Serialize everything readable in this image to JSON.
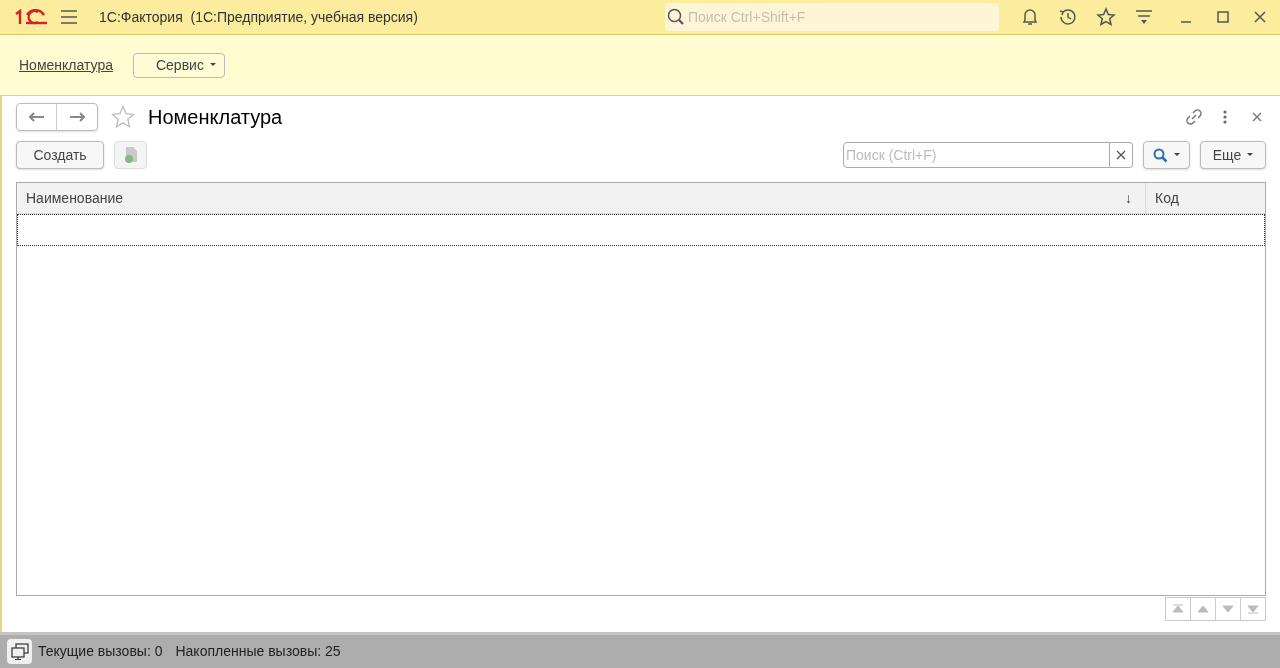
{
  "window": {
    "title": "1С:Фактория  (1С:Предприятие, учебная версия)",
    "search": {
      "placeholder": "Поиск Ctrl+Shift+F"
    }
  },
  "sections": [
    {
      "label": "Номенклатура",
      "kind": "link"
    },
    {
      "label": "Сервис",
      "kind": "dropdown"
    }
  ],
  "form": {
    "title": "Номенклатура",
    "favorite": false,
    "toolbar": {
      "create": "Создать",
      "search": {
        "placeholder": "Поиск (Ctrl+F)"
      },
      "more": "Еще"
    },
    "table": {
      "columns": [
        {
          "label": "Наименование",
          "sort": "↓"
        },
        {
          "label": "Код"
        }
      ],
      "rows": [
        {
          "selected": true
        }
      ]
    }
  },
  "status_bar": {
    "current": "Текущие вызовы: 0",
    "accumulated": "Накопленные вызовы: 25"
  }
}
